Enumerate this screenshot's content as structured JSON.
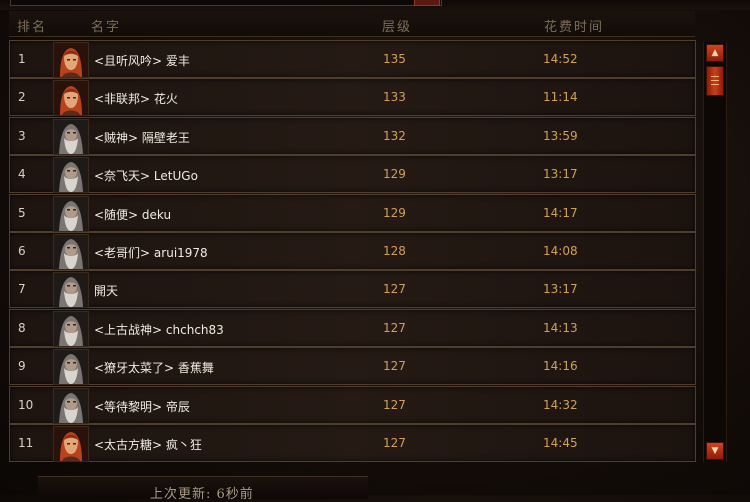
{
  "header": {
    "rank_label": "排名",
    "name_label": "名字",
    "level_label": "层级",
    "time_label": "花费时间"
  },
  "rows": [
    {
      "rank": "1",
      "name": "<且听风吟> 爱丰",
      "level": "135",
      "time": "14:52",
      "avatar": "female-barbarian-portrait-icon"
    },
    {
      "rank": "2",
      "name": "<非联邦> 花火",
      "level": "133",
      "time": "11:14",
      "avatar": "female-barbarian-portrait-icon"
    },
    {
      "rank": "3",
      "name": "<贼神> 隔壁老王",
      "level": "132",
      "time": "13:59",
      "avatar": "male-barbarian-portrait-icon"
    },
    {
      "rank": "4",
      "name": "<奈飞天> LetUGo",
      "level": "129",
      "time": "13:17",
      "avatar": "male-barbarian-portrait-icon"
    },
    {
      "rank": "5",
      "name": "<随便> deku",
      "level": "129",
      "time": "14:17",
      "avatar": "male-barbarian-portrait-icon"
    },
    {
      "rank": "6",
      "name": "<老哥们> arui1978",
      "level": "128",
      "time": "14:08",
      "avatar": "male-barbarian-portrait-icon"
    },
    {
      "rank": "7",
      "name": "開天",
      "level": "127",
      "time": "13:17",
      "avatar": "male-barbarian-portrait-icon"
    },
    {
      "rank": "8",
      "name": "<上古战神> chchch83",
      "level": "127",
      "time": "14:13",
      "avatar": "male-barbarian-portrait-icon"
    },
    {
      "rank": "9",
      "name": "<獠牙太菜了> 香蕉舞",
      "level": "127",
      "time": "14:16",
      "avatar": "male-barbarian-portrait-icon"
    },
    {
      "rank": "10",
      "name": "<等待黎明> 帝辰",
      "level": "127",
      "time": "14:32",
      "avatar": "male-barbarian-portrait-icon"
    },
    {
      "rank": "11",
      "name": "<太古方糖> 疯丶狂",
      "level": "127",
      "time": "14:45",
      "avatar": "female-barbarian-portrait-icon"
    }
  ],
  "footer": {
    "update_text": "上次更新: 6秒前"
  },
  "colors": {
    "level_time": "#cfa15a",
    "name": "#f0ebe0",
    "scroll_accent": "#c8401a"
  }
}
